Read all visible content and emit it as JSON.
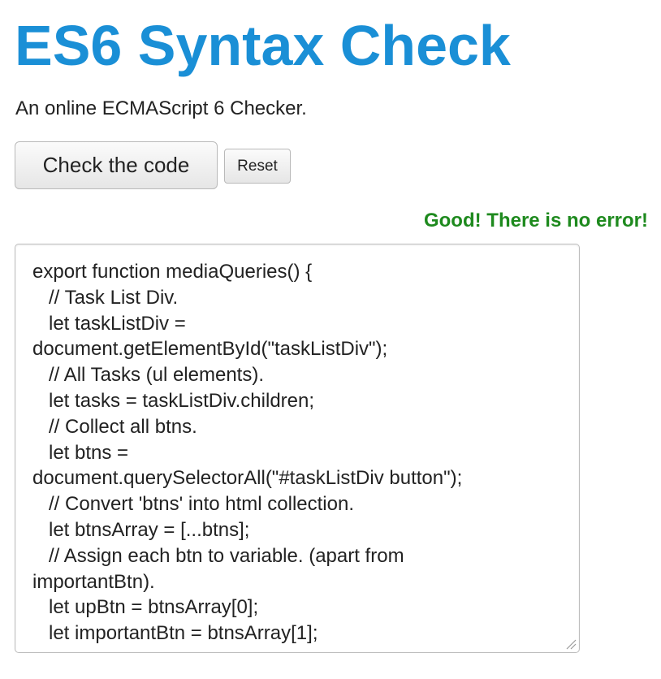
{
  "header": {
    "title": "ES6 Syntax Check",
    "subtitle": "An online ECMAScript 6 Checker."
  },
  "toolbar": {
    "check_label": "Check the code",
    "reset_label": "Reset"
  },
  "status": {
    "message": "Good! There is no error!",
    "color": "#1e8a1e"
  },
  "colors": {
    "accent": "#1a8fd6"
  },
  "editor": {
    "lines": [
      "export function mediaQueries() {",
      "   // Task List Div.",
      "   let taskListDiv =",
      "document.getElementById(\"taskListDiv\");",
      "   // All Tasks (ul elements).",
      "   let tasks = taskListDiv.children;",
      "   // Collect all btns.",
      "   let btns =",
      "document.querySelectorAll(\"#taskListDiv button\");",
      "   // Convert 'btns' into html collection.",
      "   let btnsArray = [...btns];",
      "   // Assign each btn to variable. (apart from",
      "importantBtn).",
      "   let upBtn = btnsArray[0];",
      "   let importantBtn = btnsArray[1];"
    ]
  }
}
